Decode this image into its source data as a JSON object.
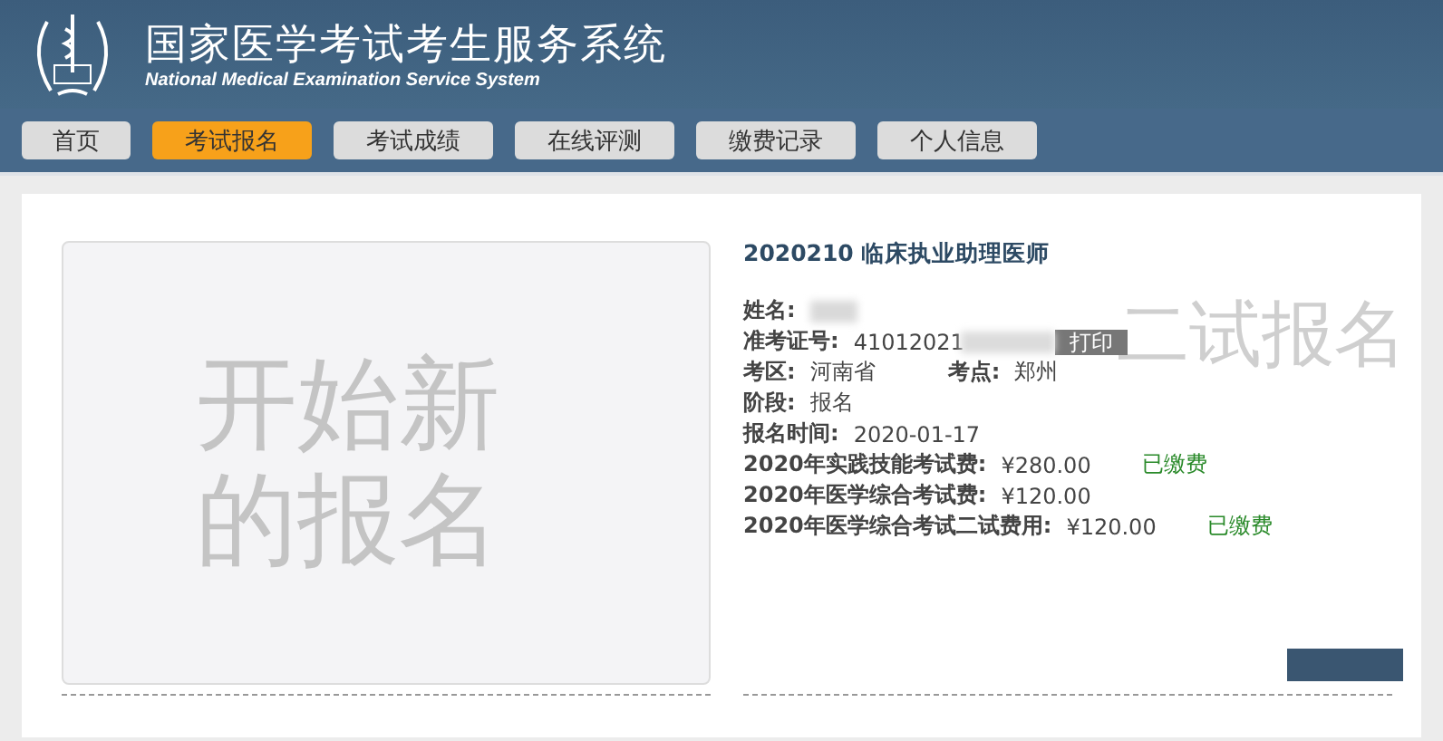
{
  "header": {
    "title": "国家医学考试考生服务系统",
    "subtitle": "National Medical Examination Service System"
  },
  "nav": [
    {
      "label": "首页",
      "selected": false
    },
    {
      "label": "考试报名",
      "selected": true
    },
    {
      "label": "考试成绩",
      "selected": false
    },
    {
      "label": "在线评测",
      "selected": false
    },
    {
      "label": "缴费记录",
      "selected": false
    },
    {
      "label": "个人信息",
      "selected": false
    }
  ],
  "new_registration": {
    "label": "开始新的报名"
  },
  "second_exam": {
    "label": "二试报名"
  },
  "registration": {
    "title": "2020210 临床执业助理医师",
    "name_label": "姓名:",
    "ticket_label": "准考证号:",
    "ticket_value": "41012021",
    "print_button": "打印",
    "area_label": "考区:",
    "area_value": "河南省",
    "site_label": "考点:",
    "site_value": "郑州",
    "stage_label": "阶段:",
    "stage_value": "报名",
    "time_label": "报名时间:",
    "time_value": "2020-01-17",
    "fees": [
      {
        "label": "2020年实践技能考试费:",
        "amount": "¥280.00",
        "status": "已缴费"
      },
      {
        "label": "2020年医学综合考试费:",
        "amount": "¥120.00"
      },
      {
        "label": "2020年医学综合考试二试费用:",
        "amount": "¥120.00",
        "status": "已缴费"
      }
    ]
  }
}
